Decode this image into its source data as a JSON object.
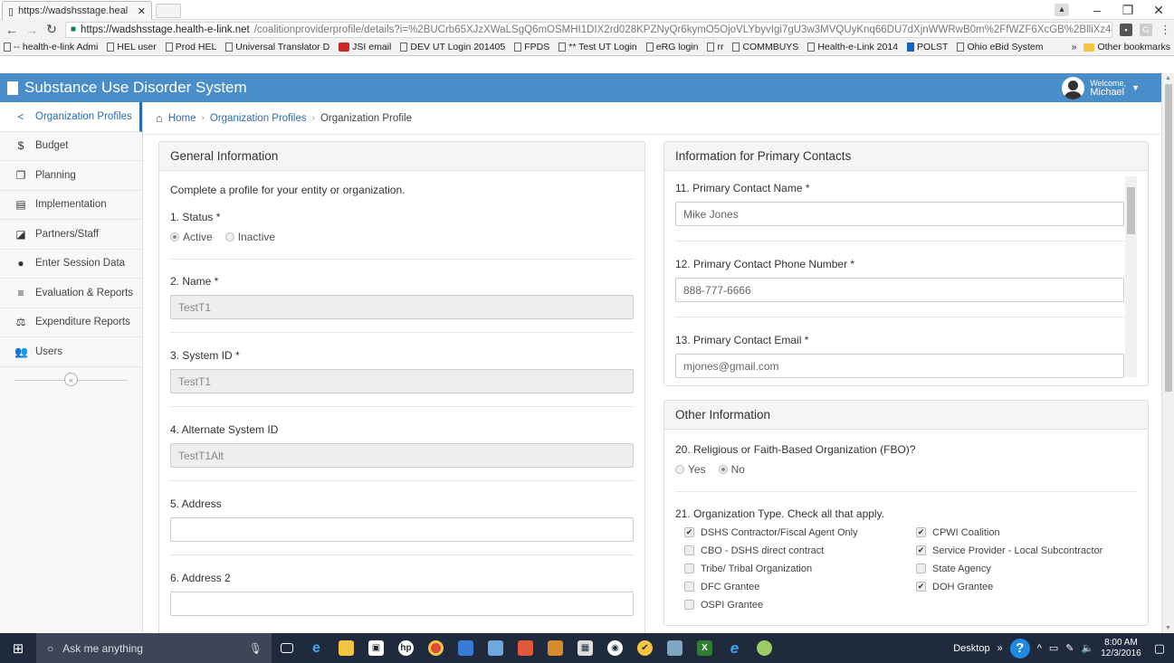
{
  "browser": {
    "tab_title": "https://wadshsstage.heal",
    "url_host": "https://wadshsstage.health-e-link.net",
    "url_path": "/coalitionproviderprofile/details?i=%2BUCrb65XJzXWaLSgQ6mOSMHI1DIX2rd028KPZNyQr6kymO5OjoVLYbyvIgi7gU3w3MVQUyKnq66DU7dXjnWWRwB0m%2FfWZF6XcGB%2BlliXz4(",
    "bookmarks": [
      "-- health-e-link Admi",
      "HEL user",
      "Prod HEL",
      "Universal Translator D",
      "JSI email",
      "DEV UT Login 201405",
      "FPDS",
      "** Test UT Login",
      "eRG login",
      "rr",
      "COMMBUYS",
      "Health-e-Link 2014",
      "POLST",
      "Ohio eBid System"
    ],
    "more_bookmarks": "»",
    "other_bookmarks": "Other bookmarks"
  },
  "header": {
    "title": "Substance Use Disorder System",
    "welcome": "Welcome,",
    "user": "Michael"
  },
  "sidebar": {
    "items": [
      {
        "label": "Organization Profiles",
        "icon": "share-icon"
      },
      {
        "label": "Budget",
        "icon": "dollar-icon"
      },
      {
        "label": "Planning",
        "icon": "copy-icon"
      },
      {
        "label": "Implementation",
        "icon": "list-icon"
      },
      {
        "label": "Partners/Staff",
        "icon": "share-square-icon"
      },
      {
        "label": "Enter Session Data",
        "icon": "user-icon"
      },
      {
        "label": "Evaluation & Reports",
        "icon": "bars-icon"
      },
      {
        "label": "Expenditure Reports",
        "icon": "balance-scale-icon"
      },
      {
        "label": "Users",
        "icon": "users-icon"
      }
    ]
  },
  "breadcrumb": {
    "home": "Home",
    "section": "Organization Profiles",
    "current": "Organization Profile"
  },
  "general": {
    "heading": "General Information",
    "intro": "Complete a profile for your entity or organization.",
    "status_label": "1. Status *",
    "status_active": "Active",
    "status_inactive": "Inactive",
    "name_label": "2. Name *",
    "name_value": "TestT1",
    "sysid_label": "3. System ID *",
    "sysid_value": "TestT1",
    "altid_label": "4. Alternate System ID",
    "altid_value": "TestT1Alt",
    "address_label": "5. Address",
    "address_value": "",
    "address2_label": "6. Address 2",
    "address2_value": ""
  },
  "contacts": {
    "heading": "Information for Primary Contacts",
    "name_label": "11. Primary Contact Name *",
    "name_value": "Mike Jones",
    "phone_label": "12. Primary Contact Phone Number *",
    "phone_value": "888-777-6666",
    "email_label": "13. Primary Contact Email *",
    "email_value": "mjones@gmail.com"
  },
  "other": {
    "heading": "Other Information",
    "fbo_label": "20. Religious or Faith-Based Organization (FBO)?",
    "fbo_yes": "Yes",
    "fbo_no": "No",
    "type_label": "21. Organization Type. Check all that apply.",
    "types": [
      {
        "label": "DSHS Contractor/Fiscal Agent Only",
        "checked": true
      },
      {
        "label": "CPWI Coalition",
        "checked": true
      },
      {
        "label": "CBO - DSHS direct contract",
        "checked": false
      },
      {
        "label": "Service Provider - Local Subcontractor",
        "checked": true
      },
      {
        "label": "Tribe/ Tribal Organization",
        "checked": false
      },
      {
        "label": "State Agency",
        "checked": false
      },
      {
        "label": "DFC Grantee",
        "checked": false
      },
      {
        "label": "DOH Grantee",
        "checked": true
      },
      {
        "label": "OSPI Grantee",
        "checked": false
      }
    ]
  },
  "taskbar": {
    "search_placeholder": "Ask me anything",
    "desktop_label": "Desktop",
    "more": "»",
    "time": "8:00 AM",
    "date": "12/3/2016"
  },
  "colors": {
    "header": "#4a8ec9",
    "link": "#2a6bb0",
    "taskbar": "#1f2b3c"
  }
}
